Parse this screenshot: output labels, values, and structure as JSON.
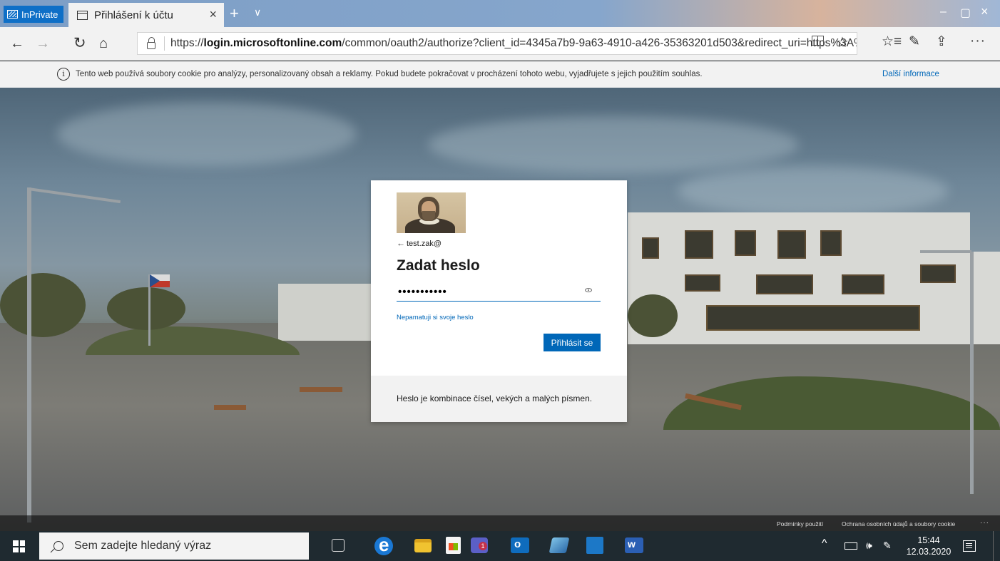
{
  "browser": {
    "inprivate_label": "InPrivate",
    "tab_title": "Přihlášení k účtu",
    "tab_close": "×",
    "new_tab": "+",
    "tab_menu": "∨",
    "window_min": "–",
    "window_max": "▢",
    "window_close": "×",
    "url_prefix": "https://",
    "url_domain": "login.microsoftonline.com",
    "url_rest": "/common/oauth2/authorize?client_id=4345a7b9-9a63-4910-a426-35363201d503&redirect_uri=https%3A%2F",
    "nav_back": "←",
    "nav_forward": "→",
    "nav_refresh": "↻",
    "nav_home": "⌂",
    "star": "☆",
    "more": "···"
  },
  "cookie_banner": {
    "info": "i",
    "text": "Tento web používá soubory cookie pro analýzy, personalizovaný obsah a reklamy. Pokud budete pokračovat v procházení tohoto webu, vyjadřujete s jejich použitím souhlas.",
    "link": "Další informace"
  },
  "signin": {
    "back_arrow": "←",
    "username": "test.zak@",
    "title": "Zadat heslo",
    "password_value": "•••••••••••",
    "forgot_link": "Nepamatuji si svoje heslo",
    "signin_button": "Přihlásit se",
    "hint": "Heslo je kombinace čísel, vekých a malých písmen."
  },
  "page_footer": {
    "terms": "Podmínky použití",
    "privacy": "Ochrana osobních údajů a soubory cookie",
    "more": "···"
  },
  "taskbar": {
    "search_placeholder": "Sem zadejte hledaný výraz",
    "teams_badge": "1",
    "tray_chevron": "^",
    "speaker": "🕪",
    "pen": "✎",
    "time": "15:44",
    "date": "12.03.2020"
  }
}
